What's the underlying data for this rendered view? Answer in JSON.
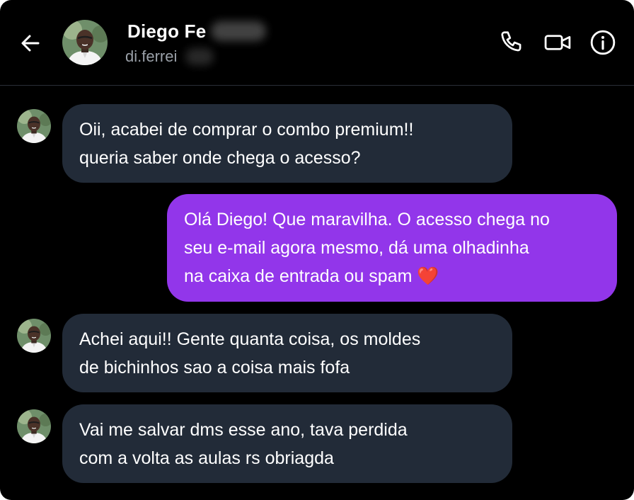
{
  "header": {
    "contact_name": "Diego Fe",
    "contact_handle": "di.ferrei",
    "icons": [
      "arrow-left-icon",
      "phone-icon",
      "video-camera-icon",
      "info-icon"
    ]
  },
  "messages": [
    {
      "direction": "incoming",
      "lines": [
        "Oii, acabei de comprar o combo premium!!",
        "queria saber onde chega o acesso?"
      ]
    },
    {
      "direction": "outgoing",
      "lines": [
        "Olá Diego! Que maravilha. O acesso chega no",
        "seu e-mail agora mesmo, dá uma olhadinha",
        "na caixa de entrada ou spam ❤️"
      ]
    },
    {
      "direction": "incoming",
      "lines": [
        "Achei aqui!! Gente quanta coisa, os moldes",
        "de bichinhos sao a coisa mais fofa"
      ]
    },
    {
      "direction": "incoming",
      "lines": [
        "Vai me salvar dms esse ano, tava perdida",
        "com a volta as aulas rs obriagda"
      ]
    }
  ],
  "colors": {
    "background": "#000000",
    "incoming_bubble": "#222b38",
    "outgoing_bubble": "#9236ea",
    "text": "#ffffff",
    "handle": "#9aa0a8"
  }
}
